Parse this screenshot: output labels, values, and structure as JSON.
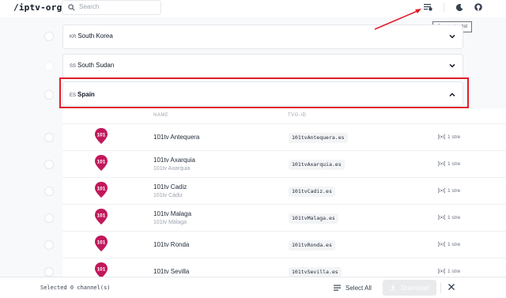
{
  "header": {
    "logo": "/iptv-org",
    "search_placeholder": "Search",
    "create_playlist_tooltip": "Create playlist"
  },
  "countries": [
    {
      "code": "KR",
      "name": "South Korea"
    },
    {
      "code": "SS",
      "name": "South Sudan"
    },
    {
      "code": "ES",
      "name": "Spain"
    }
  ],
  "table": {
    "headers": {
      "name": "NAME",
      "tvg_id": "TVG-ID"
    },
    "logo_text": "101",
    "channels": [
      {
        "name": "101tv Antequera",
        "alt": "",
        "tvg_id": "101tvAntequera.es",
        "streams": "1 stre"
      },
      {
        "name": "101tv Axarquia",
        "alt": "101tv Axarquia",
        "tvg_id": "101tvAxarquia.es",
        "streams": "1 stre"
      },
      {
        "name": "101tv Cadiz",
        "alt": "101tv Cádiz",
        "tvg_id": "101tvCadiz.es",
        "streams": "1 stre"
      },
      {
        "name": "101tv Malaga",
        "alt": "101tv Málaga",
        "tvg_id": "101tvMalaga.es",
        "streams": "1 stre"
      },
      {
        "name": "101tv Ronda",
        "alt": "",
        "tvg_id": "101tvRonda.es",
        "streams": "1 stre"
      },
      {
        "name": "101tv Sevilla",
        "alt": "",
        "tvg_id": "101tvSevilla.es",
        "streams": "1 stre"
      }
    ]
  },
  "footer": {
    "selected": "Selected 0 channel(s)",
    "select_all": "Select All",
    "download": "Download"
  },
  "colors": {
    "brand_logo": "#c2185b",
    "annotation": "#e11d2a"
  }
}
